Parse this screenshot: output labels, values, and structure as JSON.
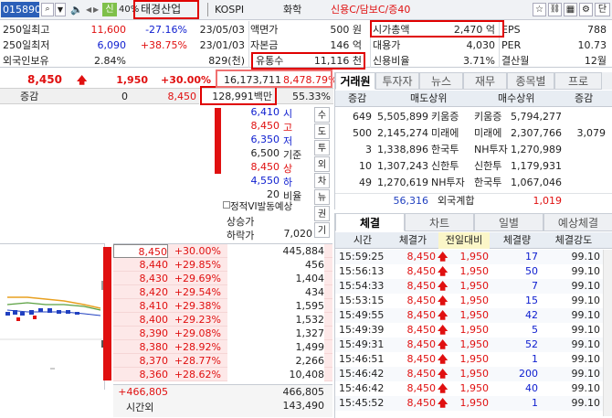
{
  "toolbar": {
    "code": "015890",
    "badge_sin": "신",
    "margin": "40%",
    "name": "태경산업",
    "market": "KOSPI",
    "sector": "화학",
    "credit": "신용C/담보C/증40",
    "danil": "단"
  },
  "info": {
    "r1": {
      "label": "250일최고",
      "price": "11,600",
      "pct": "-27.16%",
      "date": "23/05/03",
      "k1": "액면가",
      "v1": "500 원",
      "k2": "시가총액",
      "v2": "2,470 억",
      "k3": "EPS",
      "v3": "788"
    },
    "r2": {
      "label": "250일최저",
      "price": "6,090",
      "pct": "+38.75%",
      "date": "23/01/03",
      "k1": "자본금",
      "v1": "146 억",
      "k2": "대용가",
      "v2": "4,030",
      "k3": "PER",
      "v3": "10.73"
    },
    "r3": {
      "label": "외국인보유",
      "pct": "2.84%",
      "qty": "829(천)",
      "k1": "유통수",
      "v1": "11,116 천",
      "k2": "신용비율",
      "v2": "3.71%",
      "k3": "결산월",
      "v3": "12월"
    }
  },
  "quote": {
    "price": "8,450",
    "change": "1,950",
    "rate": "+30.00%",
    "volume": "16,173,711",
    "vol_rate": "8,478.79%",
    "sub_label": "증감",
    "sub_zero": "0",
    "sub_price": "8,450",
    "amount": "128,991백만",
    "ratio": "55.33%"
  },
  "mid": {
    "rows": [
      {
        "v": "6,410",
        "k": "시",
        "c": "blue"
      },
      {
        "v": "8,450",
        "k": "고",
        "c": "red"
      },
      {
        "v": "6,350",
        "k": "저",
        "c": "blue"
      },
      {
        "v": "6,500",
        "k": "기준",
        "c": "dark"
      },
      {
        "v": "8,450",
        "k": "상",
        "c": "red"
      },
      {
        "v": "4,550",
        "k": "하",
        "c": "blue"
      },
      {
        "v": "20",
        "k": "비율",
        "c": "dark"
      }
    ],
    "vi_label": "정적VI발동예상",
    "up_label": "상승가",
    "down_label": "하락가",
    "down_val": "7,020",
    "vertical_tabs": [
      "수",
      "도",
      "투",
      "외",
      "차",
      "뉴",
      "권",
      "기"
    ]
  },
  "orderbook": {
    "rows": [
      {
        "price": "8,450",
        "rate": "+30.00%",
        "qty": "445,884"
      },
      {
        "price": "8,440",
        "rate": "+29.85%",
        "qty": "456"
      },
      {
        "price": "8,430",
        "rate": "+29.69%",
        "qty": "1,404"
      },
      {
        "price": "8,420",
        "rate": "+29.54%",
        "qty": "434"
      },
      {
        "price": "8,410",
        "rate": "+29.38%",
        "qty": "1,595"
      },
      {
        "price": "8,400",
        "rate": "+29.23%",
        "qty": "1,532"
      },
      {
        "price": "8,390",
        "rate": "+29.08%",
        "qty": "1,327"
      },
      {
        "price": "8,380",
        "rate": "+28.92%",
        "qty": "1,499"
      },
      {
        "price": "8,370",
        "rate": "+28.77%",
        "qty": "2,266"
      },
      {
        "price": "8,360",
        "rate": "+28.62%",
        "qty": "10,408"
      }
    ],
    "total_left": "+466,805",
    "total_right": "466,805",
    "after_label": "시간외",
    "after_val": "143,490"
  },
  "broker": {
    "tabs": [
      "거래원",
      "투자자",
      "뉴스",
      "재무",
      "종목별",
      "프로"
    ],
    "header": [
      "증감",
      "매도상위",
      "매수상위",
      "증감"
    ],
    "rows": [
      {
        "d": "649",
        "sq": "5,505,899",
        "sn": "키움증",
        "bn": "키움증",
        "bq": "5,794,277",
        "bd": ""
      },
      {
        "d": "500",
        "sq": "2,145,274",
        "sn": "미래에",
        "bn": "미래에",
        "bq": "2,307,766",
        "bd": "3,079"
      },
      {
        "d": "3",
        "sq": "1,338,896",
        "sn": "한국투",
        "bn": "NH투자",
        "bq": "1,270,989",
        "bd": ""
      },
      {
        "d": "10",
        "sq": "1,307,243",
        "sn": "신한투",
        "bn": "신한투",
        "bq": "1,179,931",
        "bd": ""
      },
      {
        "d": "49",
        "sq": "1,270,619",
        "sn": "NH투자",
        "bn": "한국투",
        "bq": "1,067,046",
        "bd": ""
      }
    ],
    "foreign_sell": "56,316",
    "foreign_label": "외국계합",
    "foreign_buy": "1,019"
  },
  "trades": {
    "tabs": [
      "체결",
      "차트",
      "일별",
      "예상체결"
    ],
    "header": [
      "시간",
      "체결가",
      "전일대비",
      "체결량",
      "체결강도"
    ],
    "rows": [
      {
        "t": "15:59:25",
        "p": "8,450",
        "d": "1,950",
        "q": "17",
        "s": "99.10"
      },
      {
        "t": "15:56:13",
        "p": "8,450",
        "d": "1,950",
        "q": "50",
        "s": "99.10"
      },
      {
        "t": "15:54:33",
        "p": "8,450",
        "d": "1,950",
        "q": "7",
        "s": "99.10"
      },
      {
        "t": "15:53:15",
        "p": "8,450",
        "d": "1,950",
        "q": "15",
        "s": "99.10"
      },
      {
        "t": "15:49:55",
        "p": "8,450",
        "d": "1,950",
        "q": "42",
        "s": "99.10"
      },
      {
        "t": "15:49:39",
        "p": "8,450",
        "d": "1,950",
        "q": "5",
        "s": "99.10"
      },
      {
        "t": "15:49:31",
        "p": "8,450",
        "d": "1,950",
        "q": "52",
        "s": "99.10"
      },
      {
        "t": "15:46:51",
        "p": "8,450",
        "d": "1,950",
        "q": "1",
        "s": "99.10"
      },
      {
        "t": "15:46:42",
        "p": "8,450",
        "d": "1,950",
        "q": "200",
        "s": "99.10"
      },
      {
        "t": "15:46:42",
        "p": "8,450",
        "d": "1,950",
        "q": "40",
        "s": "99.10"
      },
      {
        "t": "15:45:52",
        "p": "8,450",
        "d": "1,950",
        "q": "1",
        "s": "99.10"
      }
    ]
  },
  "colors": {
    "up": "#e01010",
    "down": "#1020d0",
    "header_bg": "#e8edf3",
    "ask_bg": "#f5eded",
    "bid_bg": "#fde8e8"
  }
}
